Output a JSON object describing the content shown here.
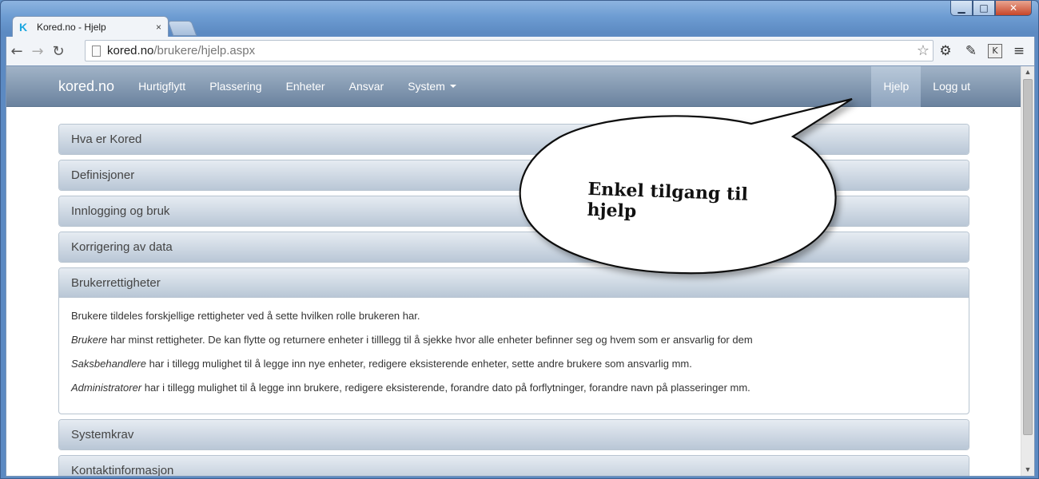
{
  "window": {
    "controls": {
      "minimize": "▁",
      "maximize": "□",
      "close": "✕"
    }
  },
  "tab": {
    "favicon": "K",
    "title": "Kored.no - Hjelp",
    "close": "×"
  },
  "toolbar": {
    "url_host": "kored.no",
    "url_path": "/brukere/hjelp.aspx",
    "icons": [
      "back-arrow-icon",
      "forward-arrow-icon",
      "reload-icon",
      "star-icon",
      "gear-icon",
      "pen-icon",
      "k-extension-icon",
      "menu-icon"
    ],
    "k_ext_label": "K"
  },
  "navbar": {
    "brand": "kored.no",
    "links": [
      "Hurtigflytt",
      "Plassering",
      "Enheter",
      "Ansvar",
      "System"
    ],
    "right_links": [
      "Hjelp",
      "Logg ut"
    ]
  },
  "panels": {
    "p0": "Hva er Kored",
    "p1": "Definisjoner",
    "p2": "Innlogging og bruk",
    "p3": "Korrigering av data",
    "p4": "Brukerrettigheter",
    "p5": "Systemkrav",
    "p6": "Kontaktinformasjon"
  },
  "brukerrettigheter": {
    "intro": "Brukere tildeles forskjellige rettigheter ved å sette hvilken rolle brukeren har.",
    "roles": [
      {
        "role": "Brukere",
        "text": " har minst rettigheter. De kan flytte og returnere enheter i tilllegg til å sjekke hvor alle enheter befinner seg og hvem som er ansvarlig for dem"
      },
      {
        "role": "Saksbehandlere",
        "text": " har i tillegg mulighet til å legge inn nye enheter, redigere eksisterende enheter, sette andre brukere som ansvarlig mm."
      },
      {
        "role": "Administratorer",
        "text": " har i tillegg mulighet til å legge inn brukere, redigere eksisterende, forandre dato på forflytninger, forandre navn på plasseringer mm."
      }
    ]
  },
  "callout": {
    "text": "Enkel tilgang til hjelp"
  }
}
